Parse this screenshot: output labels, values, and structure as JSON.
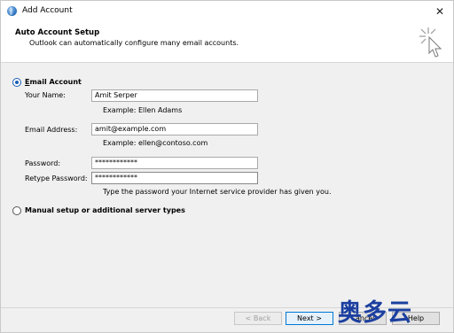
{
  "window": {
    "title": "Add Account",
    "close_glyph": "✕"
  },
  "header": {
    "title": "Auto Account Setup",
    "subtitle": "Outlook can automatically configure many email accounts.",
    "art_icon": "cursor-click-icon"
  },
  "email_account": {
    "label": "Email Account",
    "selected": true,
    "fields": {
      "name": {
        "label": "Your Name:",
        "value": "Amit Serper",
        "hint": "Example: Ellen Adams"
      },
      "email": {
        "label": "Email Address:",
        "value": "amit@example.com",
        "hint": "Example: ellen@contoso.com"
      },
      "password": {
        "label": "Password:",
        "value": "************"
      },
      "retype": {
        "label": "Retype Password:",
        "value": "************",
        "hint": "Type the password your Internet service provider has given you."
      }
    }
  },
  "manual_setup": {
    "label": "Manual setup or additional server types",
    "selected": false
  },
  "buttons": {
    "back": "< Back",
    "next": "Next >",
    "cancel": "Cancel",
    "help": "Help"
  },
  "watermark": "奥多云",
  "colors": {
    "accent": "#1a5fb4",
    "watermark": "#1b3fa0"
  }
}
